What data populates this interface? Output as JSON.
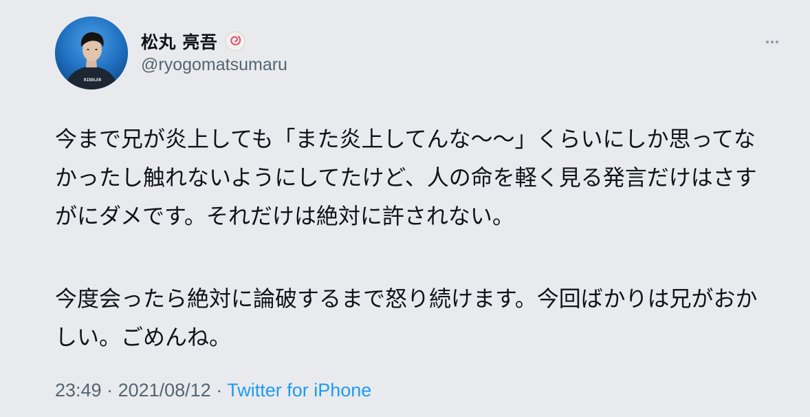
{
  "tweet": {
    "author": {
      "display_name": "松丸 亮吾",
      "handle": "@ryogomatsumaru",
      "avatar_shirt_text": "RIDDLER",
      "name_emoji": "naruto-icon"
    },
    "more_options_icon": "more-icon",
    "body": {
      "paragraph1": "今まで兄が炎上しても「また炎上してんな〜〜」くらいにしか思ってなかったし触れないようにしてたけど、人の命を軽く見る発言だけはさすがにダメです。それだけは絶対に許されない。",
      "paragraph2": "今度会ったら絶対に論破するまで怒り続けます。今回ばかりは兄がおかしい。ごめんね。"
    },
    "meta": {
      "time": "23:49",
      "separator1": " · ",
      "date": "2021/08/12",
      "separator2": " · ",
      "source": "Twitter for iPhone"
    }
  },
  "colors": {
    "background": "#e9eaed",
    "text": "#0f1419",
    "secondary": "#536471",
    "link": "#1d9bf0"
  }
}
